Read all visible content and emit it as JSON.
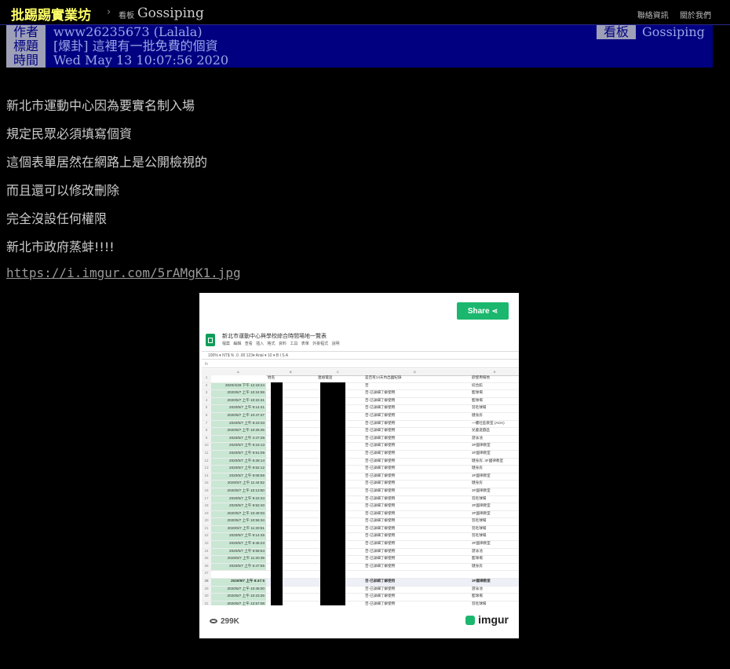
{
  "topbar": {
    "site_name": "批踢踢實業坊",
    "crumb_separator": "›",
    "board_tag": "看板",
    "board_name": "Gossiping",
    "links": [
      "聯絡資訊",
      "關於我們"
    ]
  },
  "article_header": {
    "author_label": "作者",
    "author_value": "www26235673 (Lalala)",
    "board_label": "看板",
    "board_value": "Gossiping",
    "title_label": "標題",
    "title_value": "[爆卦] 這裡有一批免費的個資",
    "time_label": "時間",
    "time_value": "Wed May 13 10:07:56 2020"
  },
  "body_lines": [
    "新北市運動中心因為要實名制入場",
    "規定民眾必須填寫個資",
    "這個表單居然在網路上是公開檢視的",
    "而且還可以修改刪除",
    "完全沒設任何權限",
    "新北市政府蒸蚌!!!!"
  ],
  "image_link": "https://i.imgur.com/5rAMgK1.jpg",
  "embed": {
    "share_label": "Share",
    "views": "299K",
    "brand": "imgur",
    "sheet": {
      "title": "新北市運動中心與學校綜合時間場地一覽表",
      "menu": "檔案 編輯 查看 插入 格式 資料 工具 表單 外掛程式 說明",
      "toolbar": "100% ▾  NT$  %  .0  .00  123▾  Arial  ▾  10  ▾  B  I  S  A",
      "formula": "fx",
      "columns": [
        "A",
        "B",
        "C",
        "D",
        "E"
      ],
      "header_row": [
        "",
        "姓名",
        "連絡電話",
        "是否有14天內出國紀錄",
        "欲使用場地"
      ],
      "rows": [
        [
          "2020/4/28 下午 12:18:24",
          "否",
          "綜合館"
        ],
        [
          "2020/5/7 上午 10:24:59",
          "否-已詳細了解使用",
          "籃球場"
        ],
        [
          "2020/5/7 上午 10:22:41",
          "否-已詳細了解使用",
          "籃球場"
        ],
        [
          "2020/5/7 上午 9:14:41",
          "否-已詳細了解使用",
          "羽毛球場"
        ],
        [
          "2020/5/7 上午 10:47:47",
          "否-已詳細了解使用",
          "健身房"
        ],
        [
          "2020/5/7 上午 8:23:33",
          "否-已詳細了解使用",
          "一樓社區教室 (AOA)"
        ],
        [
          "2020/5/7 上午 10:25:25",
          "否-已詳細了解使用",
          "兒童遊戲區"
        ],
        [
          "2020/5/7 上午 4:47:28",
          "否-已詳細了解使用",
          "游泳池"
        ],
        [
          "2020/5/7 上午 8:15:13",
          "否-已詳細了解使用",
          "3F國律教室"
        ],
        [
          "2020/5/7 上午 9:51:09",
          "否-已詳細了解使用",
          "3F國律教室"
        ],
        [
          "2020/5/7 上午 8:28:14",
          "否-已詳細了解使用",
          "健身房, 3F國律教室"
        ],
        [
          "2020/5/7 上午 8:52:12",
          "否-已詳細了解使用",
          "健身房"
        ],
        [
          "2020/5/7 上午 9:08:59",
          "否-已詳細了解使用",
          "3F國律教室"
        ],
        [
          "2020/5/7 上午 11:44:52",
          "否-已詳細了解使用",
          "健身房"
        ],
        [
          "2020/5/7 上午 10:13:50",
          "否-已詳細了解使用",
          "3F國律教室"
        ],
        [
          "2020/5/7 上午 9:22:34",
          "否-已詳細了解使用",
          "羽毛球場"
        ],
        [
          "2020/5/7 上午 9:52:40",
          "否-已詳細了解使用",
          "3F國律教室"
        ],
        [
          "2020/5/7 上午 10:49:03",
          "否-已詳細了解使用",
          "3F國律教室"
        ],
        [
          "2020/5/7 上午 10:56:34",
          "否-已詳細了解使用",
          "羽毛球場"
        ],
        [
          "2020/5/7 上午 11:20:51",
          "否-已詳細了解使用",
          "羽毛球場"
        ],
        [
          "2020/5/7 上午 9:14:45",
          "否-已詳細了解使用",
          "羽毛球場"
        ],
        [
          "2020/5/7 上午 8:45:23",
          "否-已詳細了解使用",
          "3F國律教室"
        ],
        [
          "2020/5/7 上午 9:58:54",
          "否-已詳細了解使用",
          "游泳池"
        ],
        [
          "2020/5/7 上午 11:20:39",
          "否-已詳細了解使用",
          "籃球場"
        ],
        [
          "2020/5/7 上午 5:47:55",
          "否-已詳細了解使用",
          "健身房"
        ],
        [
          "",
          "",
          ""
        ],
        [
          "2020/5/7 上午 8:47:5",
          "否-已詳細了解使用",
          "3F國律教室"
        ],
        [
          "2020/5/7 上午 10:45:00",
          "否-已詳細了解使用",
          "游泳池"
        ],
        [
          "2020/5/7 上午 10:23:26",
          "否-已詳細了解使用",
          "籃球場"
        ],
        [
          "2020/5/7 上午 12:57:08",
          "否-已詳細了解使用",
          "羽毛球場"
        ],
        [
          "2020/5/7 上午 4:30:43",
          "否-已詳細了解使用",
          "游泳池"
        ]
      ]
    }
  },
  "colors": {
    "header_bg": "#000080",
    "label_bg": "#9ea0b8",
    "site_name": "#ffff66",
    "share_green": "#1bb76e"
  }
}
